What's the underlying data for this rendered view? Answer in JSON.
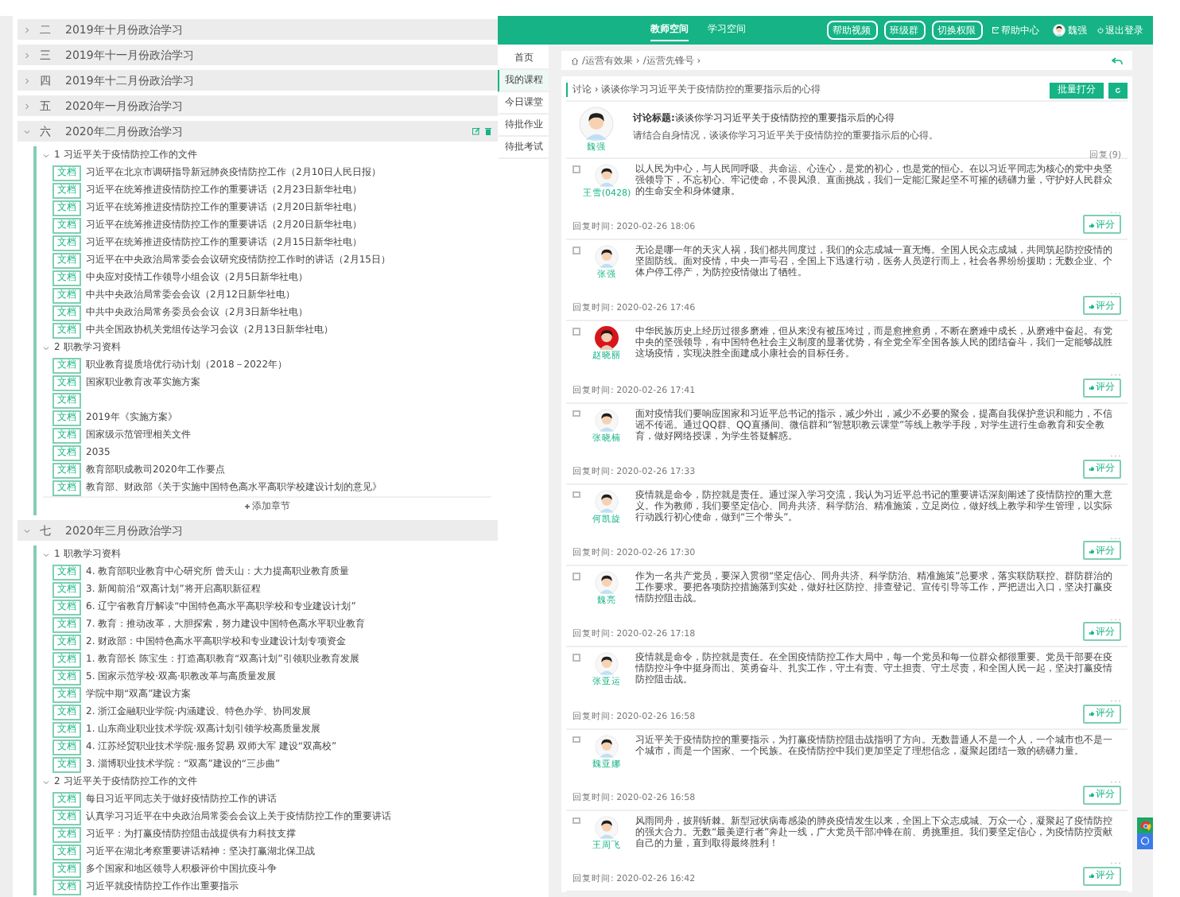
{
  "outline": {
    "chapters": [
      {
        "numeral": "二",
        "title": "2019年十月份政治学习",
        "expanded": false,
        "show_actions": false
      },
      {
        "numeral": "三",
        "title": "2019年十一月份政治学习",
        "expanded": false,
        "show_actions": false
      },
      {
        "numeral": "四",
        "title": "2019年十二月份政治学习",
        "expanded": false,
        "show_actions": false
      },
      {
        "numeral": "五",
        "title": "2020年一月份政治学习",
        "expanded": false,
        "show_actions": false
      },
      {
        "numeral": "六",
        "title": "2020年二月份政治学习",
        "expanded": true,
        "show_actions": true,
        "add_button": "添加章节",
        "sections": [
          {
            "number": "1",
            "title": "习近平关于疫情防控工作的文件",
            "expanded": true,
            "items": [
              {
                "tag": "文档",
                "title": "习近平在北京市调研指导新冠肺炎疫情防控工作（2月10日人民日报）"
              },
              {
                "tag": "文档",
                "title": "习近平在统筹推进疫情防控工作的重要讲话（2月23日新华社电）"
              },
              {
                "tag": "文档",
                "title": "习近平在统筹推进疫情防控工作的重要讲话（2月20日新华社电）"
              },
              {
                "tag": "文档",
                "title": "习近平在统筹推进疫情防控工作的重要讲话（2月20日新华社电）"
              },
              {
                "tag": "文档",
                "title": "习近平在统筹推进疫情防控工作的重要讲话（2月15日新华社电）"
              },
              {
                "tag": "文档",
                "title": "习近平在中央政治局常委会会议研究疫情防控工作时的讲话（2月15日）"
              },
              {
                "tag": "文档",
                "title": "中央应对疫情工作领导小组会议（2月5日新华社电）"
              },
              {
                "tag": "文档",
                "title": "中共中央政治局常委会会议（2月12日新华社电）"
              },
              {
                "tag": "文档",
                "title": "中共中央政治局常务委员会会议（2月3日新华社电）"
              },
              {
                "tag": "文档",
                "title": "中共全国政协机关党组传达学习会议（2月13日新华社电）"
              }
            ]
          },
          {
            "number": "2",
            "title": "职教学习资料",
            "expanded": true,
            "items": [
              {
                "tag": "文档",
                "title": "职业教育提质培优行动计划（2018－2022年）"
              },
              {
                "tag": "文档",
                "title": "国家职业教育改革实施方案"
              },
              {
                "tag": "文档"
              },
              {
                "tag": "文档",
                "title": "2019年《实施方案》"
              },
              {
                "tag": "文档",
                "title": "国家级示范管理相关文件"
              },
              {
                "tag": "文档",
                "title": "2035"
              },
              {
                "tag": "文档",
                "title": "教育部职成教司2020年工作要点"
              },
              {
                "tag": "文档",
                "title": "教育部、财政部《关于实施中国特色高水平高职学校建设计划的意见》"
              }
            ]
          }
        ]
      },
      {
        "numeral": "七",
        "title": "2020年三月份政治学习",
        "expanded": true,
        "show_actions": false,
        "sections": [
          {
            "number": "1",
            "title": "职教学习资料",
            "expanded": true,
            "items": [
              {
                "tag": "文档",
                "title": "4. 教育部职业教育中心研究所 曾天山：大力提高职业教育质量"
              },
              {
                "tag": "文档",
                "title": "3. 新闻前沿“双高计划”将开启高职新征程"
              },
              {
                "tag": "文档",
                "title": "6. 辽宁省教育厅解读“中国特色高水平高职学校和专业建设计划”"
              },
              {
                "tag": "文档",
                "title": "7. 教育：推动改革，大胆探索，努力建设中国特色高水平职业教育"
              },
              {
                "tag": "文档",
                "title": "2. 财政部：中国特色高水平高职学校和专业建设计划专项资金"
              },
              {
                "tag": "文档",
                "title": "1. 教育部长 陈宝生：打造高职教育“双高计划”引领职业教育发展"
              },
              {
                "tag": "文档",
                "title": "5. 国家示范学校·双高·职教改革与高质量发展"
              },
              {
                "tag": "文档",
                "title": "学院中期“双高”建设方案"
              },
              {
                "tag": "文档",
                "title": "2. 浙江金融职业学院·内涵建设、特色办学、协同发展"
              },
              {
                "tag": "文档",
                "title": "1. 山东商业职业技术学院·双高计划引领学校高质量发展"
              },
              {
                "tag": "文档",
                "title": "4. 江苏经贸职业技术学院·服务贸易 双师大军 建设“双高校”"
              },
              {
                "tag": "文档",
                "title": "3. 淄博职业技术学院：“双高”建设的“三步曲”"
              }
            ]
          },
          {
            "number": "2",
            "title": "习近平关于疫情防控工作的文件",
            "expanded": true,
            "items": [
              {
                "tag": "文档",
                "title": "每日习近平同志关于做好疫情防控工作的讲话"
              },
              {
                "tag": "文档",
                "title": "认真学习习近平在中央政治局常委会会议上关于疫情防控工作的重要讲话"
              },
              {
                "tag": "文档",
                "title": "习近平：为打赢疫情防控阻击战提供有力科技支撑"
              },
              {
                "tag": "文档",
                "title": "习近平在湖北考察重要讲话精神：坚决打赢湖北保卫战"
              },
              {
                "tag": "文档",
                "title": "多个国家和地区领导人积极评价中国抗疫斗争"
              },
              {
                "tag": "文档",
                "title": "习近平就疫情防控工作作出重要指示"
              }
            ]
          }
        ]
      }
    ]
  },
  "header": {
    "tabs": [
      {
        "label": "教师空间",
        "selected": true
      },
      {
        "label": "学习空间",
        "selected": false
      }
    ],
    "buttons": [
      "帮助视频",
      "班级群",
      "切换权限"
    ],
    "help": "帮助中心",
    "user": "魏强",
    "logout": "退出登录"
  },
  "sidebar": [
    {
      "label": "首页",
      "selected": false
    },
    {
      "label": "我的课程",
      "selected": true
    },
    {
      "label": "今日课堂",
      "selected": false
    },
    {
      "label": "待批作业",
      "selected": false
    },
    {
      "label": "待批考试",
      "selected": false
    }
  ],
  "breadcrumb": [
    "/运营有效果 ›",
    "/运营先锋号 ›"
  ],
  "discussion": {
    "crumb": "讨论 › 谈谈你学习习近平关于疫情防控的重要指示后的心得",
    "batch_button": "批量打分",
    "topic": {
      "author": "魏强",
      "title": "**讨论标题:**谈谈你学习习近平关于疫情防控的重要指示后的心得",
      "prompt": "请结合自身情况，谈谈你学习习近平关于疫情防控的重要指示后的心得。",
      "reply_count": "回复(9)"
    },
    "replies": [
      {
        "name": "王雪(0428)",
        "kind": "cartoon",
        "checked": false,
        "text": "以人民为中心，与人民同呼吸、共命运、心连心，是党的初心，也是党的恒心。在以习近平同志为核心的党中央坚强领导下，不忘初心、牢记使命，不畏风浪、直面挑战，我们一定能汇聚起坚不可摧的磅礴力量，守护好人民群众的生命安全和身体健康。",
        "time": "回复时间: 2020-02-26 18:06",
        "rate_button": "评分"
      },
      {
        "name": "张强",
        "kind": "cartoon",
        "checked": false,
        "text": "无论是哪一年的天灾人祸，我们都共同度过，我们的众志成城一直无悔。全国人民众志成城，共同筑起防控疫情的坚固防线。面对疫情，中央一声号召，全国上下迅速行动，医务人员逆行而上，社会各界纷纷援助；无数企业、个体户停工停产，为防控疫情做出了牺牲。",
        "time": "回复时间: 2020-02-26 17:46",
        "rate_button": "评分"
      },
      {
        "name": "赵晓丽",
        "checked": false,
        "text": "中华民族历史上经历过很多磨难，但从来没有被压垮过，而是愈挫愈勇，不断在磨难中成长，从磨难中奋起。有党中央的坚强领导，有中国特色社会主义制度的显著优势，有全党全军全国各族人民的团结奋斗，我们一定能够战胜这场疫情，实现决胜全面建成小康社会的目标任务。",
        "time": "回复时间: 2020-02-26 17:41",
        "rate_button": "评分"
      },
      {
        "name": "张晓楠",
        "kind": "cartoon",
        "checked": false,
        "text": "面对疫情我们要响应国家和习近平总书记的指示，减少外出，减少不必要的聚会，提高自我保护意识和能力，不信谣不传谣。通过QQ群、QQ直播间、微信群和“智慧职教云课堂”等线上教学手段，对学生进行生命教育和安全教育，做好网络授课，为学生答疑解惑。",
        "time": "回复时间: 2020-02-26 17:33",
        "rate_button": "评分"
      },
      {
        "name": "何凯旋",
        "kind": "cartoon",
        "checked": false,
        "text": "疫情就是命令，防控就是责任。通过深入学习交流，我认为习近平总书记的重要讲话深刻阐述了疫情防控的重大意义。作为教师，我们要坚定信心、同舟共济、科学防治、精准施策，立足岗位，做好线上教学和学生管理，以实际行动践行初心使命，做到“三个带头”。",
        "time": "回复时间: 2020-02-26 17:30",
        "rate_button": "评分"
      },
      {
        "name": "魏亮",
        "kind": "cartoon",
        "checked": false,
        "text": "作为一名共产党员，要深入贯彻“坚定信心、同舟共济、科学防治、精准施策”总要求，落实联防联控、群防群治的工作要求。要把各项防控措施落到实处，做好社区防控、排查登记、宣传引导等工作，严把进出入口，坚决打赢疫情防控阻击战。",
        "time": "回复时间: 2020-02-26 17:18",
        "rate_button": "评分"
      },
      {
        "name": "张亚运",
        "kind": "cartoon",
        "checked": false,
        "text": "疫情就是命令，防控就是责任。在全国疫情防控工作大局中，每一个党员和每一位群众都很重要。党员干部要在疫情防控斗争中挺身而出、英勇奋斗、扎实工作，守土有责、守土担责、守土尽责，和全国人民一起，坚决打赢疫情防控阻击战。",
        "time": "回复时间: 2020-02-26 16:58",
        "rate_button": "评分"
      },
      {
        "name": "魏亚娜",
        "kind": "cartoon",
        "checked": false,
        "text": "习近平关于疫情防控的重要指示，为打赢疫情防控阻击战指明了方向。无数普通人不是一个人，一个城市也不是一个城市，而是一个国家、一个民族。在疫情防控中我们更加坚定了理想信念，凝聚起团结一致的磅礴力量。",
        "time": "回复时间: 2020-02-26 16:58",
        "rate_button": "评分"
      },
      {
        "name": "王周飞",
        "kind": "cartoon",
        "checked": false,
        "text": "风雨同舟，披荆斩棘。新型冠状病毒感染的肺炎疫情发生以来，全国上下众志成城、万众一心，凝聚起了疫情防控的强大合力。无数“最美逆行者”奔赴一线，广大党员干部冲锋在前、勇挑重担。我们要坚定信心，为疫情防控贡献自己的力量，直到取得最终胜利！",
        "time": "回复时间: 2020-02-26 16:42",
        "rate_button": "评分"
      }
    ]
  }
}
